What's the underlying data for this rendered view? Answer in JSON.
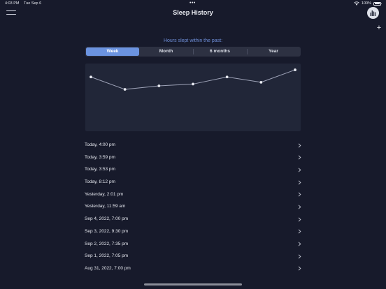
{
  "status_bar": {
    "time": "4:03 PM",
    "date": "Tue Sep 6",
    "battery_text": "100%",
    "battery_level": 1.0,
    "dots": "•••"
  },
  "header": {
    "title": "Sleep History",
    "menu_icon": "menu-icon",
    "stats_icon": "bar-chart-icon",
    "add_label": "+"
  },
  "range": {
    "label": "Hours slept within the past:",
    "segments": [
      "Week",
      "Month",
      "6 months",
      "Year"
    ],
    "selected": "Week"
  },
  "chart_data": {
    "type": "line",
    "values": [
      6.9,
      6.2,
      6.4,
      6.5,
      6.9,
      6.6,
      7.3
    ],
    "ylim": [
      4,
      7.5
    ],
    "grid": false,
    "legend": "none",
    "line_color": "#9ea3b8",
    "point_color": "#e9ebf2"
  },
  "history": [
    "Today, 4:00 pm",
    "Today, 3:59 pm",
    "Today, 3:53 pm",
    "Today, 8:12 pm",
    "Yesterday, 2:01 pm",
    "Yesterday, 11:59 am",
    "Sep 4, 2022, 7:00 pm",
    "Sep 3, 2022, 9:30 pm",
    "Sep 2, 2022, 7:35 pm",
    "Sep 1, 2022, 7:05 pm",
    "Aug 31, 2022, 7:00 pm"
  ],
  "colors": {
    "background": "#171a2b",
    "accent": "#6b93e0",
    "chart_background": "#212638"
  }
}
